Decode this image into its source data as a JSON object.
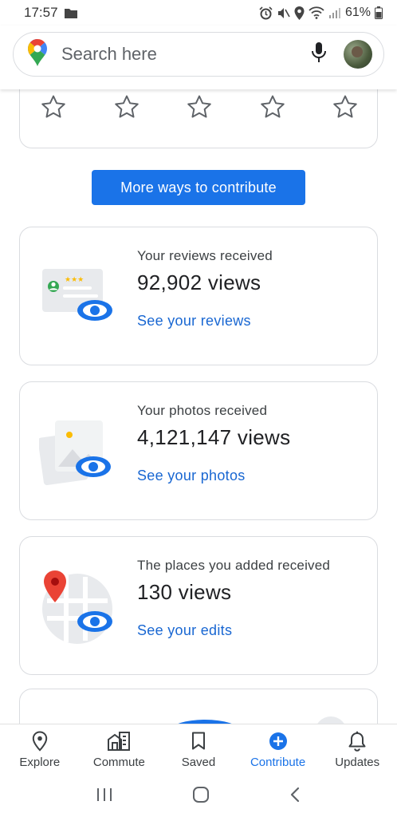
{
  "status_bar": {
    "time": "17:57",
    "battery": "61%"
  },
  "search": {
    "placeholder": "Search here"
  },
  "rating": {
    "star_count": 5
  },
  "more_ways_button": "More ways to contribute",
  "stats": [
    {
      "label": "Your reviews received",
      "value": "92,902 views",
      "link": "See your reviews",
      "illustration": "review-card-eye"
    },
    {
      "label": "Your photos received",
      "value": "4,121,147 views",
      "link": "See your photos",
      "illustration": "photo-eye"
    },
    {
      "label": "The places you added received",
      "value": "130 views",
      "link": "See your edits",
      "illustration": "map-pin-eye"
    }
  ],
  "bottom_nav": [
    {
      "label": "Explore",
      "icon": "location-pin-icon",
      "active": false
    },
    {
      "label": "Commute",
      "icon": "commute-icon",
      "active": false
    },
    {
      "label": "Saved",
      "icon": "bookmark-icon",
      "active": false
    },
    {
      "label": "Contribute",
      "icon": "plus-circle-icon",
      "active": true
    },
    {
      "label": "Updates",
      "icon": "bell-icon",
      "active": false
    }
  ],
  "colors": {
    "accent": "#1a73e8",
    "link": "#1967d2",
    "pin_red": "#ea4335"
  }
}
